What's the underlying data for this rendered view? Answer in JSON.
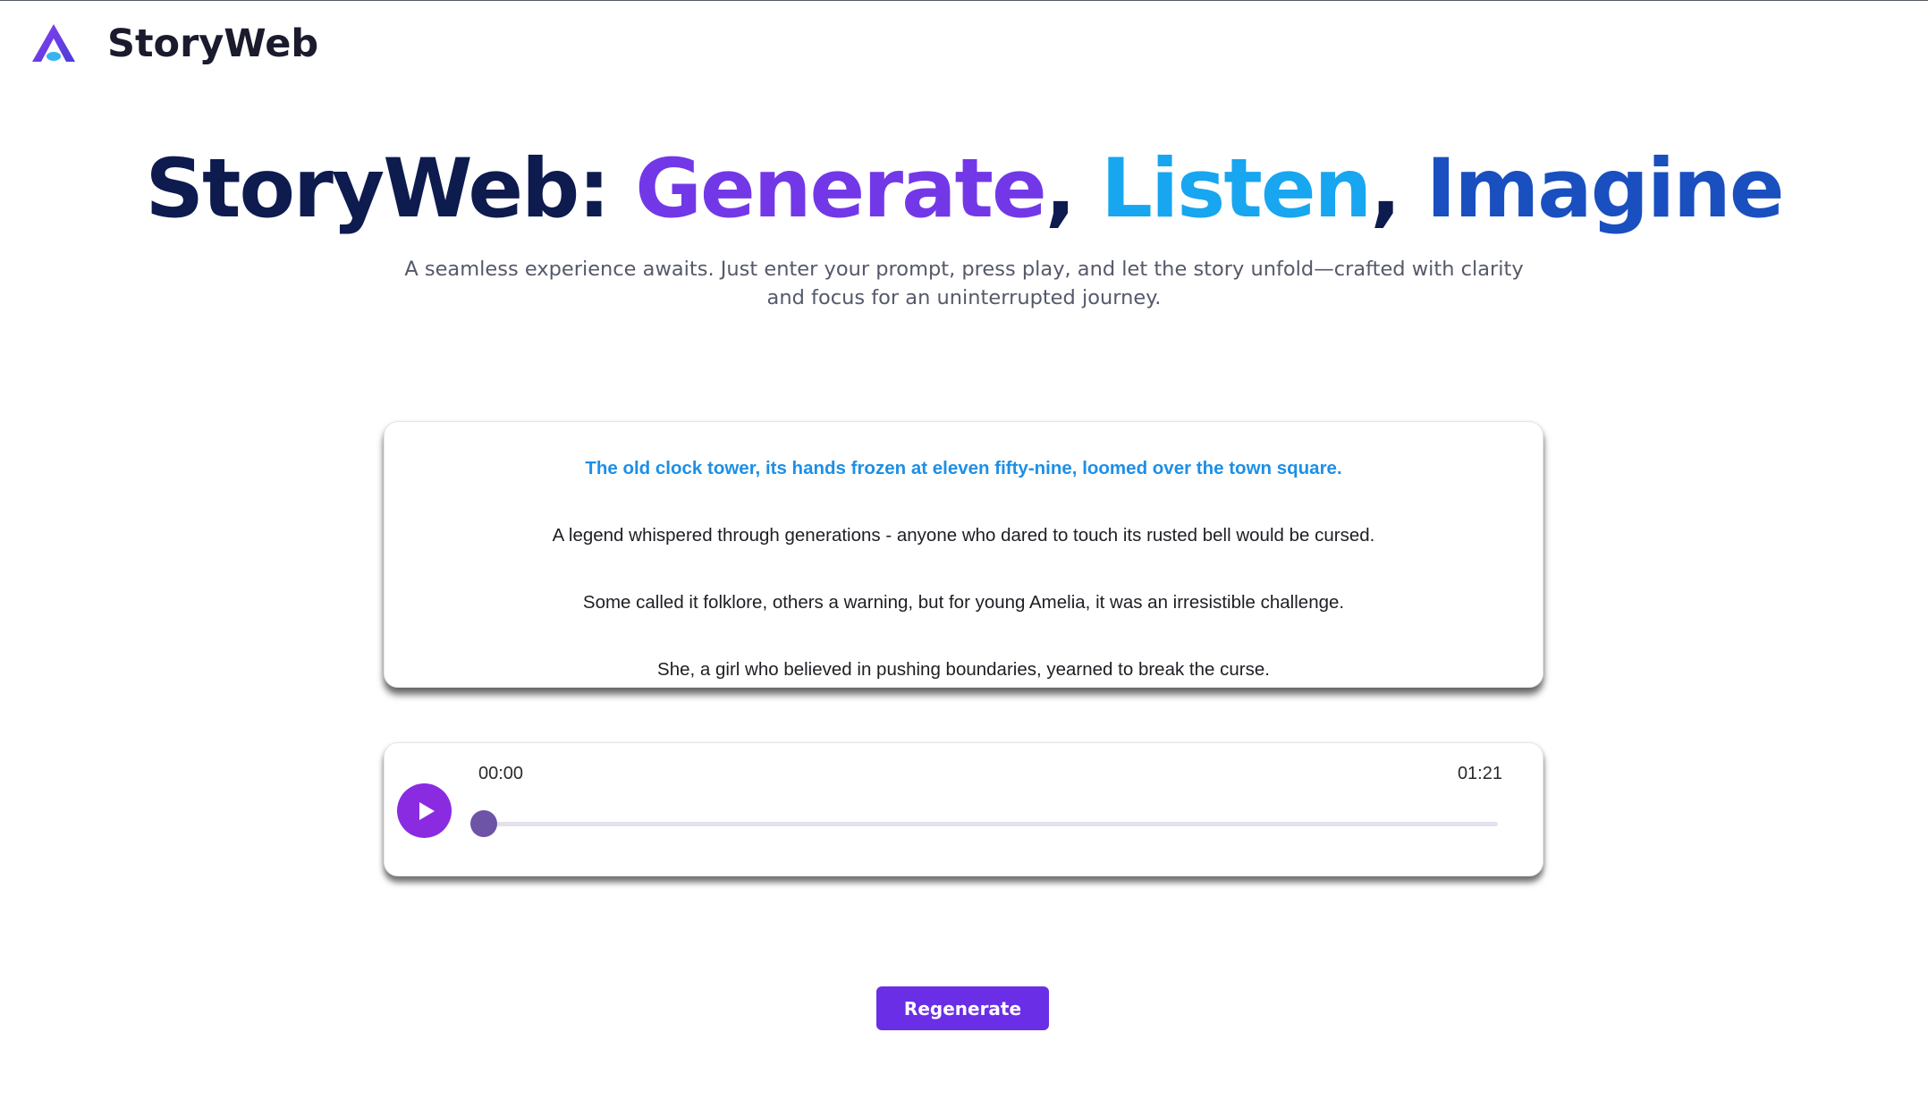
{
  "header": {
    "brand": "StoryWeb",
    "logo_icon": "storyweb-logo-icon"
  },
  "hero": {
    "title_prefix": "StoryWeb: ",
    "word_generate": "Generate",
    "sep_1": ", ",
    "word_listen": "Listen",
    "sep_2": ", ",
    "word_imagine": "Imagine",
    "subtitle": "A seamless experience awaits. Just enter your prompt, press play, and let the story unfold—crafted with clarity and focus for an uninterrupted journey."
  },
  "story": {
    "lines": [
      "The old clock tower, its hands frozen at eleven fifty-nine, loomed over the town square.",
      "A legend whispered through generations - anyone who dared to touch its rusted bell would be cursed.",
      "Some called it folklore, others a warning, but for young Amelia, it was an irresistible challenge.",
      "She, a girl who believed in pushing boundaries, yearned to break the curse."
    ],
    "active_index": 0,
    "active_color": "#1d8fe6"
  },
  "player": {
    "play_icon": "play-icon",
    "current_time": "00:00",
    "total_time": "01:21",
    "progress": 0.0,
    "accent_color": "#8a2be2"
  },
  "actions": {
    "regenerate_label": "Regenerate"
  },
  "colors": {
    "title_dark": "#0d1b4f",
    "generate": "#7238e8",
    "listen": "#17a6ef",
    "imagine": "#1a4fbf",
    "button": "#6a2ee6"
  }
}
